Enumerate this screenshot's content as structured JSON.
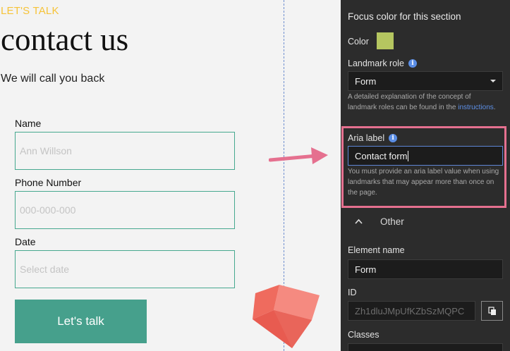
{
  "page": {
    "eyebrow": "LET'S TALK",
    "title": "contact us",
    "subtitle": "We will call you back",
    "fields": [
      {
        "label": "Name",
        "placeholder": "Ann Willson"
      },
      {
        "label": "Phone Number",
        "placeholder": "000-000-000"
      },
      {
        "label": "Date",
        "placeholder": "Select date"
      }
    ],
    "submit_label": "Let's talk"
  },
  "panel": {
    "heading": "Focus color for this section",
    "color_label": "Color",
    "color_value": "#b5c660",
    "landmark_label": "Landmark role",
    "landmark_value": "Form",
    "landmark_help": "A detailed explanation of the concept of landmark roles can be found in the",
    "landmark_help_link": "instructions",
    "landmark_help_end": ".",
    "aria_label": "Aria label",
    "aria_value": "Contact form",
    "aria_help": "You must provide an aria label value when using landmarks that may appear more than once on the page.",
    "other_label": "Other",
    "element_name_label": "Element name",
    "element_name_value": "Form",
    "id_label": "ID",
    "id_value": "Zh1dluJMpUfKZbSzMQPC",
    "classes_label": "Classes"
  },
  "icons": {
    "info": "info-icon",
    "dropdown": "caret-down-icon",
    "collapse": "chevron-up-icon",
    "copy": "copy-icon",
    "arrow": "arrow-right-icon",
    "cube": "cube-icon"
  },
  "colors": {
    "accent_yellow": "#f6c338",
    "field_border": "#46a88f",
    "button": "#46a08c",
    "highlight": "#e5708f",
    "link": "#5d8fe6"
  }
}
